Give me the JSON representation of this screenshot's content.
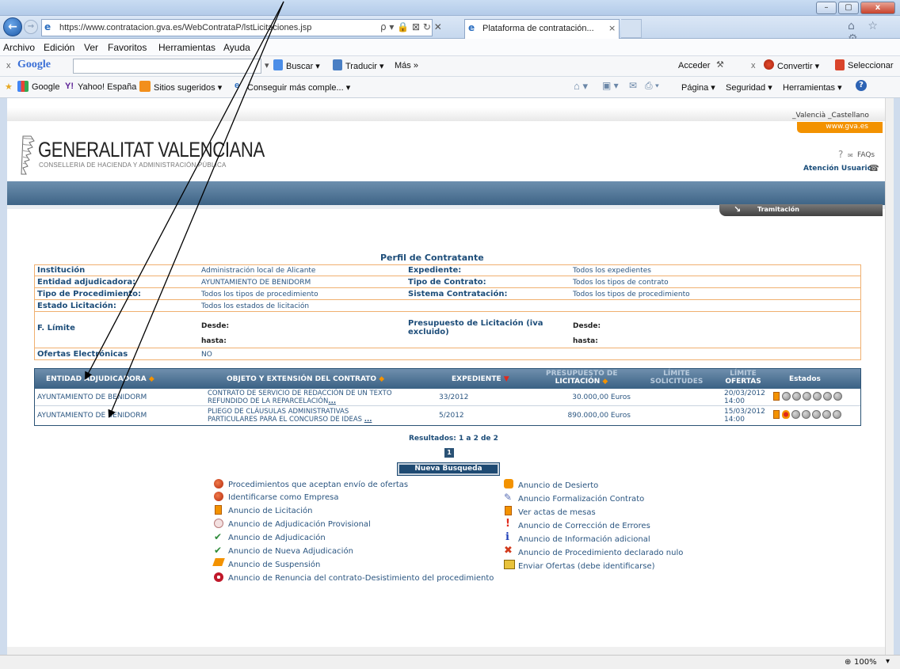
{
  "browser": {
    "url": "https://www.contratacion.gva.es/WebContrataP/lstLicitaciones.jsp",
    "address_tools": "ρ ▾ 🔒 ⊠ ↻ ✕",
    "tab_title": "Plataforma de contratación...",
    "tab_close": "×",
    "window_buttons": [
      "–",
      "▢",
      "x"
    ],
    "nav_right": "⌂ ☆ ⚙"
  },
  "menubar": {
    "items": [
      "Archivo",
      "Edición",
      "Ver",
      "Favoritos",
      "Herramientas",
      "Ayuda"
    ]
  },
  "google_bar": {
    "close": "x",
    "logo": "Google",
    "buscar": "Buscar ▾",
    "traducir": "Traducir ▾",
    "mas": "Más »",
    "acceder": "Acceder",
    "convertir": "Convertir ▾",
    "seleccionar": "Seleccionar"
  },
  "favorites_bar": {
    "items": [
      "Google",
      "Yahoo! España",
      "Sitios sugeridos ▾",
      "Conseguir más comple... ▾"
    ],
    "right_items": [
      "Página ▾",
      "Seguridad ▾",
      "Herramientas ▾"
    ]
  },
  "site": {
    "lang_links": "_Valencià   _Castellano",
    "gva_tab": "www.gva.es",
    "logo_name": "GENERALITAT VALENCIANA",
    "logo_sub": "CONSELLERIA DE HACIENDA Y ADMINISTRACIÓN PÚBLICA",
    "faq": "FAQs",
    "atencion": "Atención Usuario",
    "tramitacion": "Tramitación",
    "perfil_title": "Perfil de Contratante"
  },
  "criteria": {
    "institucion_label": "Institución",
    "institucion_value": "Administración local de Alicante",
    "expediente_label": "Expediente:",
    "expediente_value": "Todos los expedientes",
    "entidad_label": "Entidad adjudicadora:",
    "entidad_value": "AYUNTAMIENTO DE BENIDORM",
    "tipo_contrato_label": "Tipo de Contrato:",
    "tipo_contrato_value": "Todos los tipos de contrato",
    "tipo_proc_label": "Tipo de Procedimiento:",
    "tipo_proc_value": "Todos los tipos de procedimiento",
    "sistema_label": "Sistema Contratación:",
    "sistema_value": "Todos los tipos de procedimiento",
    "estado_label": "Estado Licitación:",
    "estado_value": "Todos los estados de licitación",
    "flimite_label": "F. Límite",
    "desde": "Desde:",
    "hasta": "hasta:",
    "presupuesto_label": "Presupuesto de Licitación (iva excluido)",
    "presupuesto_label_1": "Presupuesto de Licitación (iva",
    "presupuesto_label_2": "excluido)",
    "ofertas_label": "Ofertas Electrónicas",
    "ofertas_value": "NO"
  },
  "results": {
    "headers": {
      "entidad": "ENTIDAD ADJUDICADORA",
      "objeto": "OBJETO Y EXTENSIÓN DEL CONTRATO",
      "expediente": "EXPEDIENTE",
      "presupuesto_1": "PRESUPUESTO DE",
      "presupuesto_2": "LICITACIÓN",
      "solicitudes_1": "LÍMITE",
      "solicitudes_2": "SOLICITUDES",
      "ofertas_1": "LÍMITE",
      "ofertas_2": "OFERTAS",
      "estados": "Estados"
    },
    "rows": [
      {
        "entidad": "AYUNTAMIENTO DE BENIDORM",
        "objeto_1": "CONTRATO DE SERVICIO DE REDACCIÓN DE UN TEXTO",
        "objeto_2": "REFUNDIDO DE LA REPARCELACIÓN",
        "more": "...",
        "expediente": "33/2012",
        "presupuesto": "30.000,00 Euros",
        "fecha": "20/03/2012",
        "hora": "14:00"
      },
      {
        "entidad": "AYUNTAMIENTO DE BENIDORM",
        "objeto_1": "PLIEGO DE CLÁUSULAS ADMINISTRATIVAS",
        "objeto_2": "PARTICULARES PARA EL CONCURSO DE IDEAS",
        "more": "...",
        "expediente": "5/2012",
        "presupuesto": "890.000,00 Euros",
        "fecha": "15/03/2012",
        "hora": "14:00"
      }
    ],
    "resultados": "Resultados: 1 a 2 de 2",
    "page": "1",
    "nueva_busqueda": "Nueva Busqueda"
  },
  "legend": {
    "left": [
      "Procedimientos que aceptan envío de ofertas",
      "Identificarse como Empresa",
      "Anuncio de Licitación",
      "Anuncio de Adjudicación Provisional",
      "Anuncio de Adjudicación",
      "Anuncio de Nueva Adjudicación",
      "Anuncio de Suspensión",
      "Anuncio de Renuncia del contrato-Desistimiento del procedimiento"
    ],
    "right": [
      "Anuncio de Desierto",
      "Anuncio Formalización Contrato",
      "Ver actas de mesas",
      "Anuncio de Corrección de Errores",
      "Anuncio de Información adicional",
      "Anuncio de Procedimiento declarado nulo",
      "Enviar Ofertas (debe identificarse)"
    ]
  },
  "status": {
    "zoom": "100%"
  },
  "colors": {
    "accent_orange": "#f39200",
    "header_blue": "#3e6486",
    "link_blue": "#2a5580"
  }
}
